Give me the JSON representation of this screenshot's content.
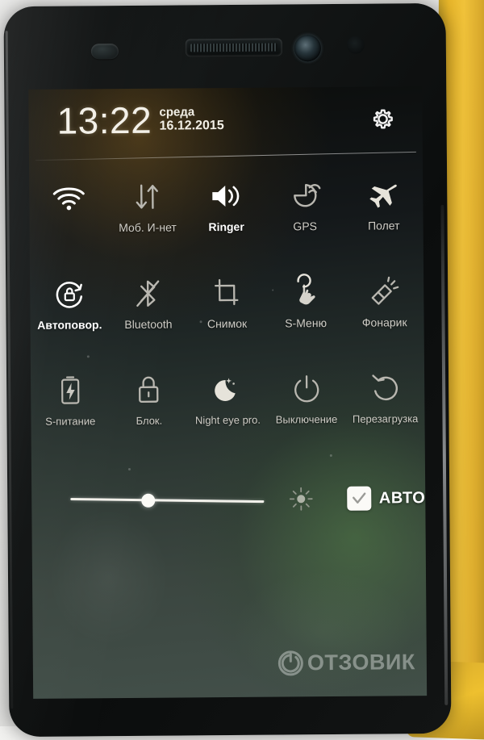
{
  "scene": {
    "device": "smartphone",
    "case_color": "#e8b62a",
    "bezel_color": "#101313",
    "screen_tint": "#2f3a35"
  },
  "statusbar": {
    "time": "13:22",
    "day_name": "среда",
    "date": "16.12.2015",
    "settings_icon": "gear-icon"
  },
  "quick_settings": {
    "rows": [
      [
        {
          "icon": "wifi-icon",
          "label": "",
          "state": "on"
        },
        {
          "icon": "mobile-data-icon",
          "label": "Моб. И-нет",
          "state": "off"
        },
        {
          "icon": "ringer-icon",
          "label": "Ringer",
          "state": "on"
        },
        {
          "icon": "gps-icon",
          "label": "GPS",
          "state": "off"
        },
        {
          "icon": "airplane-icon",
          "label": "Полет",
          "state": "off"
        }
      ],
      [
        {
          "icon": "auto-rotate-icon",
          "label": "Автоповор.",
          "state": "on"
        },
        {
          "icon": "bluetooth-off-icon",
          "label": "Bluetooth",
          "state": "off"
        },
        {
          "icon": "screenshot-icon",
          "label": "Снимок",
          "state": "off"
        },
        {
          "icon": "s-menu-hand-icon",
          "label": "S-Меню",
          "state": "off"
        },
        {
          "icon": "flashlight-icon",
          "label": "Фонарик",
          "state": "off"
        }
      ],
      [
        {
          "icon": "battery-saver-icon",
          "label": "S-питание",
          "state": "off"
        },
        {
          "icon": "lock-icon",
          "label": "Блок.",
          "state": "off"
        },
        {
          "icon": "night-mode-moon-icon",
          "label": "Night eye pro.",
          "state": "off"
        },
        {
          "icon": "power-off-icon",
          "label": "Выключение",
          "state": "off"
        },
        {
          "icon": "restart-icon",
          "label": "Перезагрузка",
          "state": "off"
        }
      ]
    ]
  },
  "brightness": {
    "slider_value_percent": 37,
    "brightness_icon": "sun-icon",
    "auto_label": "АВТО",
    "auto_checked": true
  },
  "watermark": {
    "text": "ОТЗОВИК",
    "logo": "otzovik-circle-logo"
  }
}
